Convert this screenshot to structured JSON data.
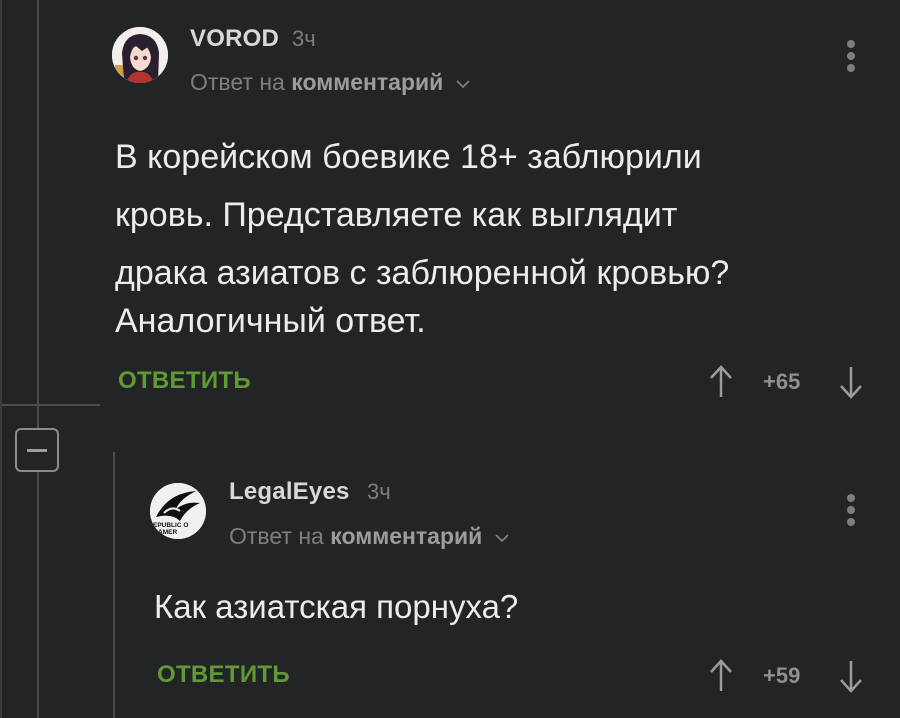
{
  "comments": [
    {
      "username": "VOROD",
      "time": "3ч",
      "reply_prefix": "Ответ на",
      "reply_target": "комментарий",
      "lines": [
        "В корейском боевике 18+ заблюрили",
        "кровь. Представляете как выглядит",
        "драка азиатов с заблюренной кровью?",
        "Аналогичный ответ."
      ],
      "reply_label": "ОТВЕТИТЬ",
      "score": "+65"
    },
    {
      "username": "LegalEyes",
      "time": "3ч",
      "reply_prefix": "Ответ на",
      "reply_target": "комментарий",
      "lines": [
        "Как азиатская порнуха?"
      ],
      "reply_label": "ОТВЕТИТЬ",
      "score": "+59",
      "avatar_text_top": "EPUBLIC O",
      "avatar_text_bottom": "AMER"
    }
  ],
  "icons": {
    "upvote": "arrow-up-icon",
    "downvote": "arrow-down-icon",
    "menu": "more-vertical-icon",
    "collapse": "minus-icon",
    "expand_reply": "chevron-down-icon"
  },
  "colors": {
    "background": "#232426",
    "accent_green": "#5f9a35",
    "muted": "#7c7e81",
    "text": "#ececec"
  }
}
